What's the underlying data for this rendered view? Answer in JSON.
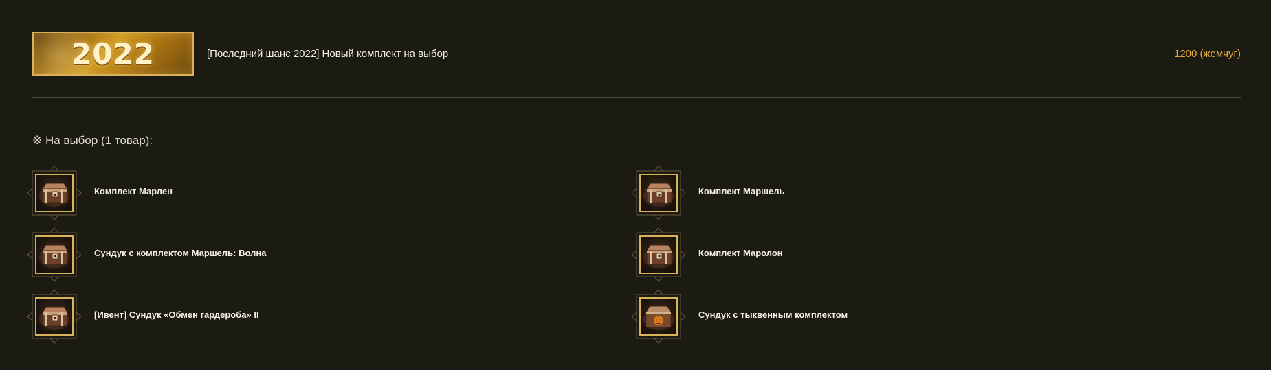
{
  "header": {
    "banner_text": "2022",
    "title": "[Последний шанс 2022] Новый комплект на выбор",
    "price": "1200 (жемчуг)"
  },
  "choice": {
    "heading": "※ На выбор (1 товар):"
  },
  "items": [
    {
      "label": "Комплект Марлен",
      "icon": "wooden-chest-icon"
    },
    {
      "label": "Комплект Маршель",
      "icon": "wooden-chest-icon"
    },
    {
      "label": "Сундук с комплектом Маршель: Волна",
      "icon": "wooden-chest-icon"
    },
    {
      "label": "Комплект Маролон",
      "icon": "wooden-chest-icon"
    },
    {
      "label": "[Ивент] Сундук «Обмен гардероба» II",
      "icon": "wooden-chest-icon"
    },
    {
      "label": "Сундук с тыквенным комплектом",
      "icon": "pumpkin-chest-icon"
    }
  ],
  "colors": {
    "background": "#1b1a13",
    "accent_gold": "#d9b25c",
    "price": "#e2aa3c",
    "text": "#f4f0e7"
  }
}
